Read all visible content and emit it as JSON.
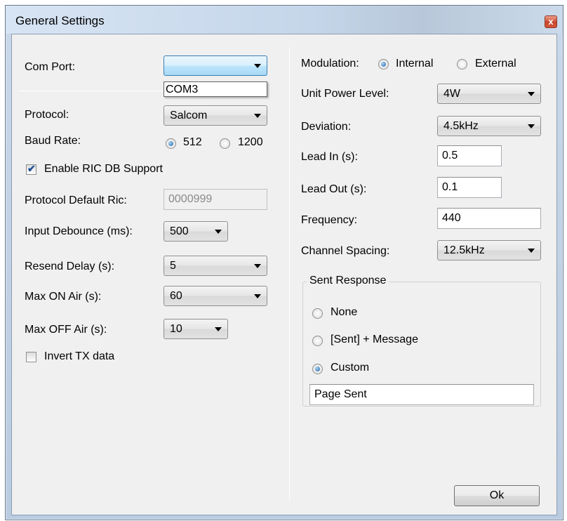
{
  "window": {
    "title": "General Settings",
    "close_glyph": "x"
  },
  "left": {
    "com_port_label": "Com Port:",
    "com_port_value": "",
    "com_port_option": "COM3",
    "protocol_label": "Protocol:",
    "protocol_value": "Salcom",
    "baud_label": "Baud Rate:",
    "baud_option_1": "512",
    "baud_option_2": "1200",
    "baud_selected": "512",
    "enable_ric_label": "Enable RIC DB Support",
    "enable_ric_checked": true,
    "protocol_ric_label": "Protocol Default Ric:",
    "protocol_ric_value": "0000999",
    "input_debounce_label": "Input Debounce (ms):",
    "input_debounce_value": "500",
    "resend_delay_label": "Resend Delay (s):",
    "resend_delay_value": "5",
    "max_on_label": "Max ON Air (s):",
    "max_on_value": "60",
    "max_off_label": "Max OFF Air (s):",
    "max_off_value": "10",
    "invert_tx_label": "Invert TX data",
    "invert_tx_checked": false
  },
  "right": {
    "modulation_label": "Modulation:",
    "modulation_option_1": "Internal",
    "modulation_option_2": "External",
    "modulation_selected": "Internal",
    "unit_power_label": "Unit Power Level:",
    "unit_power_value": "4W",
    "deviation_label": "Deviation:",
    "deviation_value": "4.5kHz",
    "lead_in_label": "Lead In (s):",
    "lead_in_value": "0.5",
    "lead_out_label": "Lead Out (s):",
    "lead_out_value": "0.1",
    "frequency_label": "Frequency:",
    "frequency_value": "440",
    "channel_spacing_label": "Channel Spacing:",
    "channel_spacing_value": "12.5kHz",
    "sent_response": {
      "legend": "Sent Response",
      "option_none": "None",
      "option_sent_message": "[Sent] + Message",
      "option_custom": "Custom",
      "selected": "Custom",
      "custom_value": "Page Sent"
    }
  },
  "ok_label": "Ok",
  "colors": {
    "title_bar": "#c5d6ea",
    "close_button": "#c9462c",
    "client_bg": "#f0f0f0",
    "active_combo": "#bee6fd"
  }
}
